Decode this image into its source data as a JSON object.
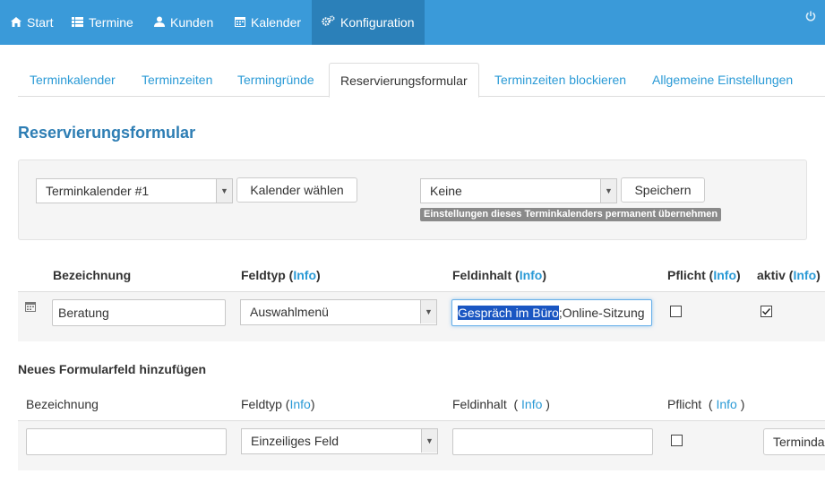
{
  "nav": {
    "start": "Start",
    "termine": "Termine",
    "kunden": "Kunden",
    "kalender": "Kalender",
    "konfiguration": "Konfiguration"
  },
  "tabs": {
    "terminkalender": "Terminkalender",
    "terminzeiten": "Terminzeiten",
    "termingruende": "Termingründe",
    "reservierungsformular": "Reservierungsformular",
    "terminzeiten_blockieren": "Terminzeiten blockieren",
    "allgemeine_einstellungen": "Allgemeine Einstellungen"
  },
  "page_title": "Reservierungsformular",
  "panel": {
    "calendar_select": "Terminkalender #1",
    "choose_button": "Kalender wählen",
    "template_select": "Keine",
    "save_button": "Speichern",
    "hint_badge": "Einstellungen dieses Terminkalenders permanent übernehmen"
  },
  "table": {
    "headers": {
      "bezeichnung": "Bezeichnung",
      "feldtyp": "Feldtyp",
      "feldinhalt": "Feldinhalt",
      "pflicht": "Pflicht",
      "aktiv": "aktiv",
      "info": "Info"
    },
    "row": {
      "bezeichnung": "Beratung",
      "feldtyp": "Auswahlmenü",
      "feldinhalt_selected": "Gespräch im Büro",
      "feldinhalt_rest": ";Online-Sitzung",
      "pflicht": false,
      "aktiv": true
    }
  },
  "new_field": {
    "title": "Neues Formularfeld hinzufügen",
    "headers": {
      "bezeichnung": "Bezeichnung",
      "feldtyp": "Feldtyp",
      "feldinhalt": "Feldinhalt",
      "pflicht": "Pflicht",
      "info": "Info"
    },
    "feldtyp_value": "Einzeiliges Feld",
    "calendar_value": "Terminda"
  },
  "colors": {
    "nav_bg": "#3a9ad9",
    "nav_active": "#2b80b9",
    "link": "#2a9ad6",
    "title": "#2e7eb4",
    "selection": "#1a56c2"
  }
}
